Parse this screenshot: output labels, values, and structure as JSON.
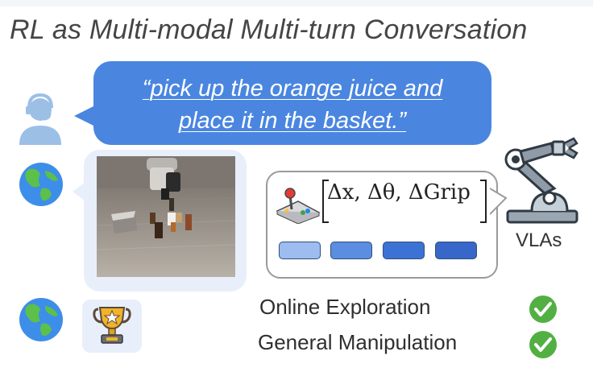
{
  "title": "RL as Multi-modal Multi-turn Conversation",
  "instruction": {
    "line1": "“pick up the orange juice and",
    "line2": "place it in the basket.”"
  },
  "action": {
    "formula": "Δx, Δθ, ΔGrip",
    "token_colors": [
      "#9dbcef",
      "#5b8de0",
      "#3b72d4",
      "#3767c9"
    ]
  },
  "agent_label": "VLAs",
  "features": [
    {
      "label": "Online Exploration",
      "checked": true
    },
    {
      "label": "General Manipulation",
      "checked": true
    }
  ],
  "icons": {
    "user": "user-headset-icon",
    "world_obs": "globe-icon",
    "world_reward": "globe-icon",
    "reward": "trophy-icon",
    "controller": "joystick-icon",
    "robot": "robot-arm-icon",
    "check": "check-icon"
  },
  "colors": {
    "user_bubble": "#4a86e0",
    "env_bubble": "#e8effa",
    "check_green": "#52b043",
    "robot_gray": "#7f8c99"
  }
}
